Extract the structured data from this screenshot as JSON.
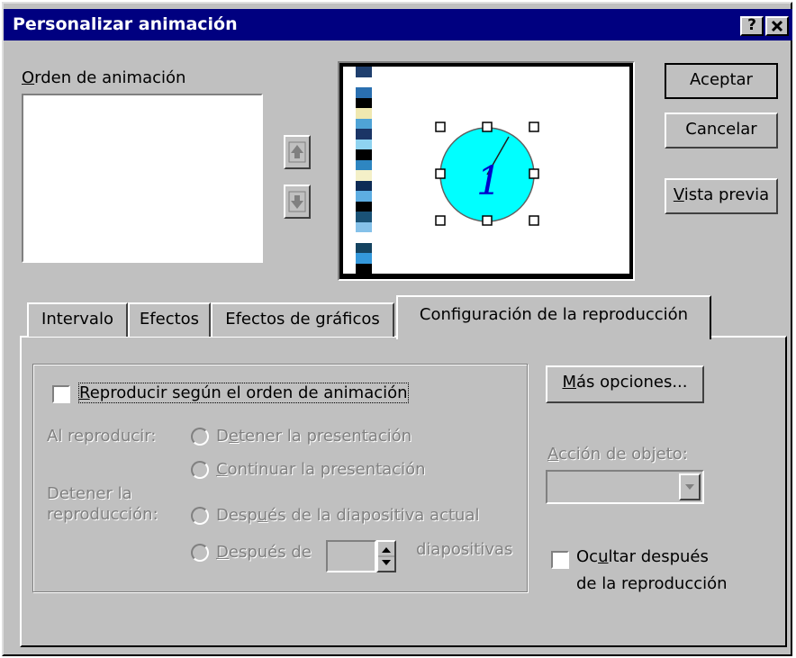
{
  "window": {
    "title": "Personalizar animación",
    "help_button": "?",
    "close_button": "×"
  },
  "order": {
    "label_mnemonic": "O",
    "label_rest": "rden de animación",
    "items": []
  },
  "buttons": {
    "accept": "Aceptar",
    "cancel": "Cancelar",
    "preview_mnemonic": "V",
    "preview_rest": "ista previa",
    "move_up_icon": "arrow-up-icon",
    "move_down_icon": "arrow-down-icon"
  },
  "preview": {
    "clock_numeral": "1",
    "stripe_colors": [
      "#1f3f6e",
      "#ffffff",
      "#2a6fb0",
      "#000000",
      "#f0e8b0",
      "#4fa3d6",
      "#1b3566",
      "#8fd3f0",
      "#000000",
      "#2e86c1",
      "#f4f0c8",
      "#0d2b55",
      "#5dade2",
      "#000000",
      "#1a5276",
      "#85c1e9",
      "#ffffff",
      "#154360",
      "#3498db",
      "#000000"
    ],
    "accent_color": "#00ffff"
  },
  "tabs": [
    {
      "label": "Intervalo"
    },
    {
      "label": "Efectos"
    },
    {
      "label": "Efectos de gráficos"
    },
    {
      "label": "Configuración de la reproducción"
    }
  ],
  "playback": {
    "play_in_order_mnemonic": "R",
    "play_in_order_rest": "eproducir según el orden de animación",
    "play_in_order_checked": false,
    "on_play_label": "Al reproducir:",
    "pause_pre": "D",
    "pause_mnemonic": "e",
    "pause_rest": "tener la presentación",
    "continue_mnemonic": "C",
    "continue_rest": "ontinuar la presentación",
    "stop_label_line1": "Detener la",
    "stop_label_line2": "reproducción:",
    "after_current_pre": "Desp",
    "after_current_mnemonic": "u",
    "after_current_rest": "és de la diapositiva actual",
    "after_n_mnemonic": "D",
    "after_n_rest": "espués de",
    "after_n_value": "",
    "slides_label": "diapositivas",
    "more_options_mnemonic": "M",
    "more_options_rest": "ás opciones...",
    "object_action_mnemonic": "A",
    "object_action_rest": "cción de objeto:",
    "object_action_value": "",
    "hide_pre": "Oc",
    "hide_mnemonic": "u",
    "hide_rest": "ltar después",
    "hide_line2": "de la reproducción",
    "hide_checked": false
  }
}
